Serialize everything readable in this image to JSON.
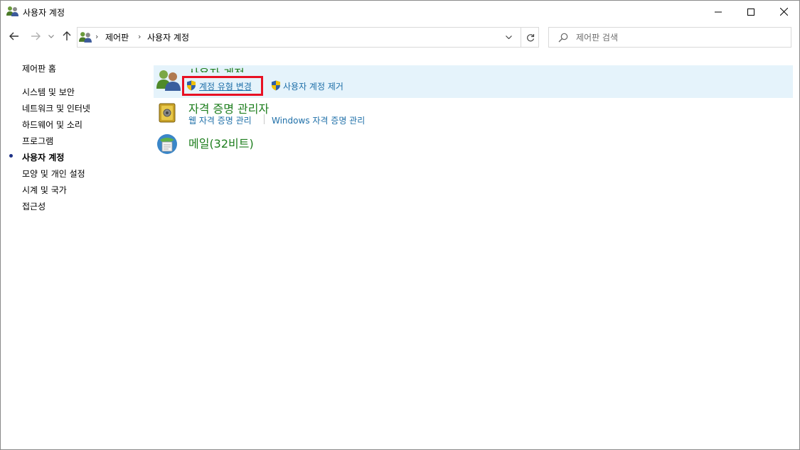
{
  "window": {
    "title": "사용자 계정"
  },
  "address": {
    "crumbs": [
      "제어판",
      "사용자 계정"
    ]
  },
  "search": {
    "placeholder": "제어판 검색"
  },
  "sidebar": {
    "home": "제어판 홈",
    "items": [
      {
        "label": "시스템 및 보안",
        "active": false
      },
      {
        "label": "네트워크 및 인터넷",
        "active": false
      },
      {
        "label": "하드웨어 및 소리",
        "active": false
      },
      {
        "label": "프로그램",
        "active": false
      },
      {
        "label": "사용자 계정",
        "active": true
      },
      {
        "label": "모양 및 개인 설정",
        "active": false
      },
      {
        "label": "시계 및 국가",
        "active": false
      },
      {
        "label": "접근성",
        "active": false
      }
    ]
  },
  "categories": [
    {
      "title": "사용자 계정",
      "icon": "user-accounts-icon",
      "links": [
        "계정 유형 변경",
        "사용자 계정 제거"
      ]
    },
    {
      "title": "자격 증명 관리자",
      "icon": "credential-manager-icon",
      "links": [
        "웹 자격 증명 관리",
        "Windows 자격 증명 관리"
      ]
    },
    {
      "title": "메일(32비트)",
      "icon": "mail-icon",
      "links": []
    }
  ],
  "colors": {
    "category_title": "#1e7e1e",
    "link": "#1e6fa8",
    "highlight_bg": "#e5f3fb",
    "annotation_box": "#e81123"
  }
}
